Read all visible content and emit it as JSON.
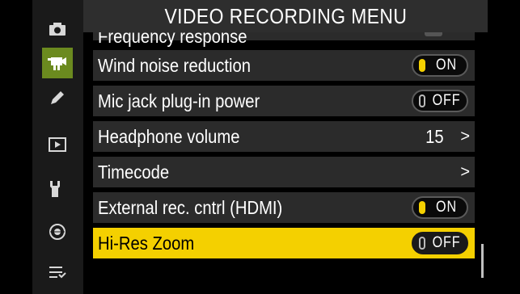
{
  "header": {
    "title": "VIDEO RECORDING MENU"
  },
  "sidebar": {
    "items": [
      {
        "icon": "camera-icon",
        "active": false
      },
      {
        "icon": "movie-camera-icon",
        "active": true
      },
      {
        "icon": "pencil-icon",
        "active": false
      },
      {
        "icon": "playback-icon",
        "active": false
      },
      {
        "icon": "wrench-icon",
        "active": false
      },
      {
        "icon": "network-icon",
        "active": false
      },
      {
        "icon": "my-menu-icon",
        "active": false
      }
    ]
  },
  "menu": {
    "items": [
      {
        "label": "Frequency response",
        "partial": true
      },
      {
        "label": "Wind noise reduction",
        "toggle": "ON"
      },
      {
        "label": "Mic jack plug-in power",
        "toggle": "OFF"
      },
      {
        "label": "Headphone volume",
        "value": "15",
        "chevron": ">"
      },
      {
        "label": "Timecode",
        "chevron": ">"
      },
      {
        "label": "External rec. cntrl (HDMI)",
        "toggle": "ON"
      },
      {
        "label": "Hi-Res Zoom",
        "toggle": "OFF",
        "selected": true
      }
    ]
  },
  "colors": {
    "accent": "#f4d000",
    "active_tab": "#6b8a1f",
    "row_bg": "#2b2b2b"
  }
}
